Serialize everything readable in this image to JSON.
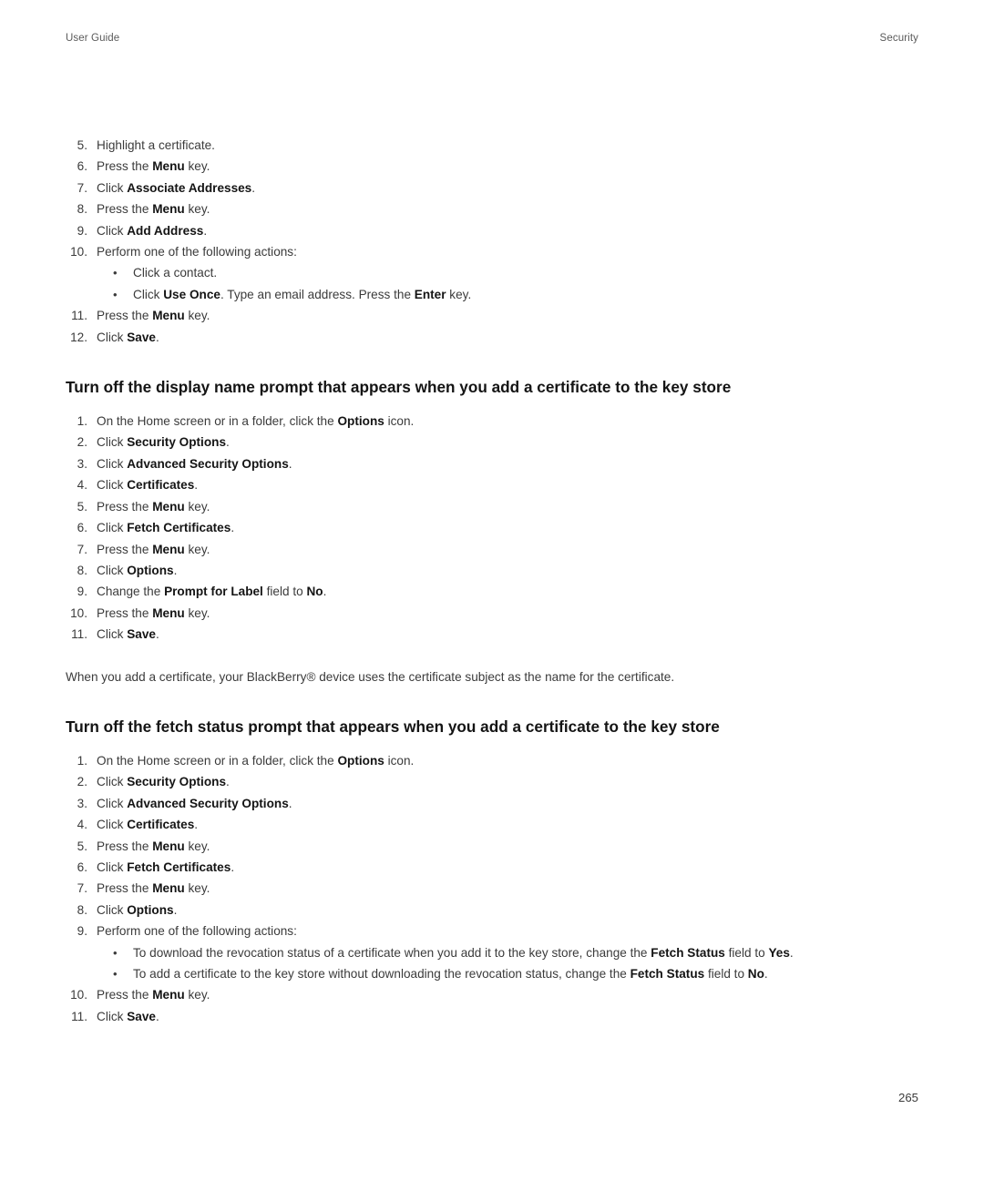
{
  "header": {
    "left": "User Guide",
    "right": "Security"
  },
  "blocks": [
    {
      "kind": "ordered-list",
      "name": "associate-addresses-steps",
      "items": [
        {
          "num": "5.",
          "segments": [
            {
              "t": "Highlight a certificate."
            }
          ]
        },
        {
          "num": "6.",
          "segments": [
            {
              "t": "Press the "
            },
            {
              "t": "Menu",
              "b": true
            },
            {
              "t": " key."
            }
          ]
        },
        {
          "num": "7.",
          "segments": [
            {
              "t": "Click "
            },
            {
              "t": "Associate Addresses",
              "b": true
            },
            {
              "t": "."
            }
          ]
        },
        {
          "num": "8.",
          "segments": [
            {
              "t": "Press the "
            },
            {
              "t": "Menu",
              "b": true
            },
            {
              "t": " key."
            }
          ]
        },
        {
          "num": "9.",
          "segments": [
            {
              "t": "Click "
            },
            {
              "t": "Add Address",
              "b": true
            },
            {
              "t": "."
            }
          ]
        },
        {
          "num": "10.",
          "segments": [
            {
              "t": "Perform one of the following actions:"
            }
          ],
          "bullets": [
            {
              "segments": [
                {
                  "t": "Click a contact."
                }
              ]
            },
            {
              "segments": [
                {
                  "t": "Click "
                },
                {
                  "t": "Use Once",
                  "b": true
                },
                {
                  "t": ". Type an email address. Press the "
                },
                {
                  "t": "Enter",
                  "b": true
                },
                {
                  "t": " key."
                }
              ]
            }
          ]
        },
        {
          "num": "11.",
          "segments": [
            {
              "t": "Press the "
            },
            {
              "t": "Menu",
              "b": true
            },
            {
              "t": " key."
            }
          ]
        },
        {
          "num": "12.",
          "segments": [
            {
              "t": "Click "
            },
            {
              "t": "Save",
              "b": true
            },
            {
              "t": "."
            }
          ]
        }
      ]
    },
    {
      "kind": "heading",
      "name": "heading-display-name-prompt",
      "text": "Turn off the display name prompt that appears when you add a certificate to the key store"
    },
    {
      "kind": "ordered-list",
      "name": "display-name-prompt-steps",
      "items": [
        {
          "num": "1.",
          "segments": [
            {
              "t": "On the Home screen or in a folder, click the "
            },
            {
              "t": "Options",
              "b": true
            },
            {
              "t": " icon."
            }
          ]
        },
        {
          "num": "2.",
          "segments": [
            {
              "t": "Click "
            },
            {
              "t": "Security Options",
              "b": true
            },
            {
              "t": "."
            }
          ]
        },
        {
          "num": "3.",
          "segments": [
            {
              "t": "Click "
            },
            {
              "t": "Advanced Security Options",
              "b": true
            },
            {
              "t": "."
            }
          ]
        },
        {
          "num": "4.",
          "segments": [
            {
              "t": "Click "
            },
            {
              "t": "Certificates",
              "b": true
            },
            {
              "t": "."
            }
          ]
        },
        {
          "num": "5.",
          "segments": [
            {
              "t": "Press the "
            },
            {
              "t": "Menu",
              "b": true
            },
            {
              "t": " key."
            }
          ]
        },
        {
          "num": "6.",
          "segments": [
            {
              "t": "Click "
            },
            {
              "t": "Fetch Certificates",
              "b": true
            },
            {
              "t": "."
            }
          ]
        },
        {
          "num": "7.",
          "segments": [
            {
              "t": "Press the "
            },
            {
              "t": "Menu",
              "b": true
            },
            {
              "t": " key."
            }
          ]
        },
        {
          "num": "8.",
          "segments": [
            {
              "t": "Click "
            },
            {
              "t": "Options",
              "b": true
            },
            {
              "t": "."
            }
          ]
        },
        {
          "num": "9.",
          "segments": [
            {
              "t": "Change the "
            },
            {
              "t": "Prompt for Label",
              "b": true
            },
            {
              "t": " field to "
            },
            {
              "t": "No",
              "b": true
            },
            {
              "t": "."
            }
          ]
        },
        {
          "num": "10.",
          "segments": [
            {
              "t": "Press the "
            },
            {
              "t": "Menu",
              "b": true
            },
            {
              "t": " key."
            }
          ]
        },
        {
          "num": "11.",
          "segments": [
            {
              "t": "Click "
            },
            {
              "t": "Save",
              "b": true
            },
            {
              "t": "."
            }
          ]
        }
      ]
    },
    {
      "kind": "paragraph",
      "name": "certificate-subject-note",
      "text": "When you add a certificate, your BlackBerry® device uses the certificate subject as the name for the certificate."
    },
    {
      "kind": "heading",
      "name": "heading-fetch-status-prompt",
      "text": "Turn off the fetch status prompt that appears when you add a certificate to the key store"
    },
    {
      "kind": "ordered-list",
      "name": "fetch-status-prompt-steps",
      "items": [
        {
          "num": "1.",
          "segments": [
            {
              "t": "On the Home screen or in a folder, click the "
            },
            {
              "t": "Options",
              "b": true
            },
            {
              "t": " icon."
            }
          ]
        },
        {
          "num": "2.",
          "segments": [
            {
              "t": "Click "
            },
            {
              "t": "Security Options",
              "b": true
            },
            {
              "t": "."
            }
          ]
        },
        {
          "num": "3.",
          "segments": [
            {
              "t": "Click "
            },
            {
              "t": "Advanced Security Options",
              "b": true
            },
            {
              "t": "."
            }
          ]
        },
        {
          "num": "4.",
          "segments": [
            {
              "t": "Click "
            },
            {
              "t": "Certificates",
              "b": true
            },
            {
              "t": "."
            }
          ]
        },
        {
          "num": "5.",
          "segments": [
            {
              "t": "Press the "
            },
            {
              "t": "Menu",
              "b": true
            },
            {
              "t": " key."
            }
          ]
        },
        {
          "num": "6.",
          "segments": [
            {
              "t": "Click "
            },
            {
              "t": "Fetch Certificates",
              "b": true
            },
            {
              "t": "."
            }
          ]
        },
        {
          "num": "7.",
          "segments": [
            {
              "t": "Press the "
            },
            {
              "t": "Menu",
              "b": true
            },
            {
              "t": " key."
            }
          ]
        },
        {
          "num": "8.",
          "segments": [
            {
              "t": "Click "
            },
            {
              "t": "Options",
              "b": true
            },
            {
              "t": "."
            }
          ]
        },
        {
          "num": "9.",
          "segments": [
            {
              "t": "Perform one of the following actions:"
            }
          ],
          "bullets": [
            {
              "segments": [
                {
                  "t": "To download the revocation status of a certificate when you add it to the key store, change the "
                },
                {
                  "t": "Fetch Status",
                  "b": true
                },
                {
                  "t": " field to "
                },
                {
                  "t": "Yes",
                  "b": true
                },
                {
                  "t": "."
                }
              ]
            },
            {
              "segments": [
                {
                  "t": "To add a certificate to the key store without downloading the revocation status, change the "
                },
                {
                  "t": "Fetch Status",
                  "b": true
                },
                {
                  "t": " field to "
                },
                {
                  "t": "No",
                  "b": true
                },
                {
                  "t": "."
                }
              ]
            }
          ]
        },
        {
          "num": "10.",
          "segments": [
            {
              "t": "Press the "
            },
            {
              "t": "Menu",
              "b": true
            },
            {
              "t": " key."
            }
          ]
        },
        {
          "num": "11.",
          "segments": [
            {
              "t": "Click "
            },
            {
              "t": "Save",
              "b": true
            },
            {
              "t": "."
            }
          ]
        }
      ]
    }
  ],
  "footer": {
    "page_number": "265"
  },
  "bullet_glyph": "•",
  "colors": {
    "body_text": "#3b3b3b",
    "emphasis_text": "#141414",
    "header_text": "#5a5a5a",
    "page_background": "#ffffff"
  }
}
